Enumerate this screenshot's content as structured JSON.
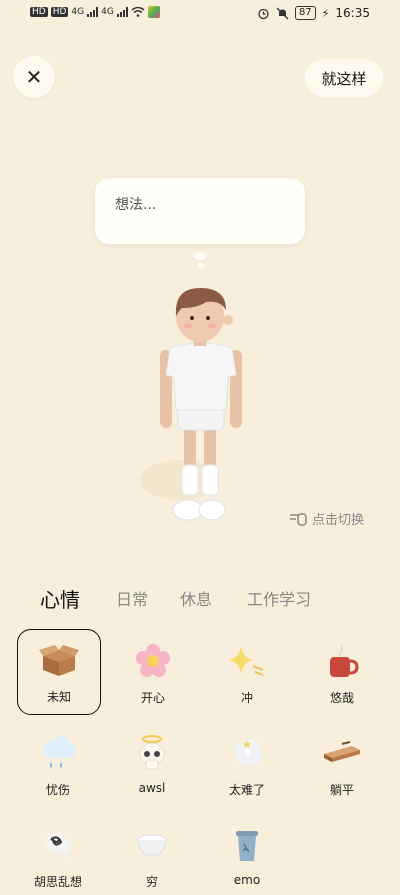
{
  "status": {
    "left_tags": [
      "HD",
      "HD"
    ],
    "network": [
      "4G",
      "4G"
    ],
    "battery": "87",
    "time": "16:35"
  },
  "header": {
    "close_symbol": "✕",
    "done_label": "就这样"
  },
  "bubble": {
    "placeholder": "想法..."
  },
  "switch": {
    "label": "点击切换"
  },
  "tabs": [
    {
      "label": "心情",
      "active": true
    },
    {
      "label": "日常",
      "active": false
    },
    {
      "label": "休息",
      "active": false
    },
    {
      "label": "工作学习",
      "active": false
    }
  ],
  "moods": [
    {
      "label": "未知",
      "icon": "box-icon",
      "selected": true
    },
    {
      "label": "开心",
      "icon": "flower-icon",
      "selected": false
    },
    {
      "label": "冲",
      "icon": "sparkle-icon",
      "selected": false
    },
    {
      "label": "悠哉",
      "icon": "mug-icon",
      "selected": false
    },
    {
      "label": "忧伤",
      "icon": "rain-cloud-icon",
      "selected": false
    },
    {
      "label": "awsl",
      "icon": "angel-skull-icon",
      "selected": false
    },
    {
      "label": "太难了",
      "icon": "dizzy-cloud-icon",
      "selected": false
    },
    {
      "label": "躺平",
      "icon": "lying-flat-icon",
      "selected": false
    },
    {
      "label": "胡思乱想",
      "icon": "messy-thoughts-icon",
      "selected": false
    },
    {
      "label": "穷",
      "icon": "empty-bowl-icon",
      "selected": false
    },
    {
      "label": "emo",
      "icon": "trash-can-icon",
      "selected": false
    }
  ]
}
